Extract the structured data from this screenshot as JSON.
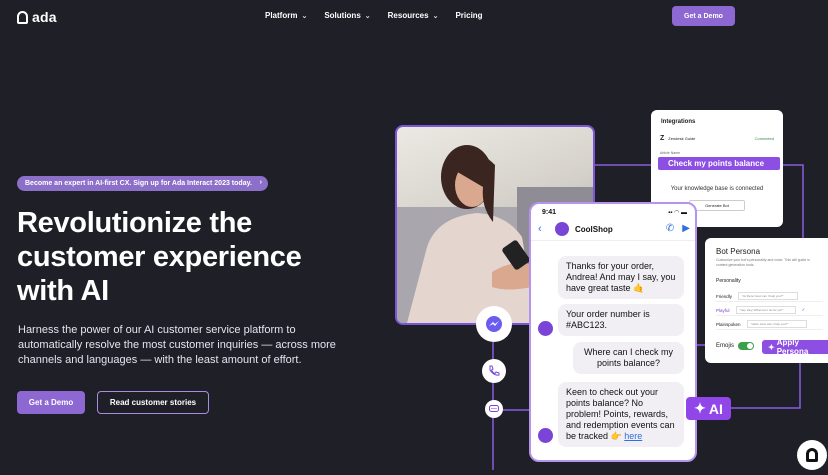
{
  "brand": {
    "name": "ada"
  },
  "nav": {
    "items": [
      {
        "label": "Platform",
        "dropdown": true
      },
      {
        "label": "Solutions",
        "dropdown": true
      },
      {
        "label": "Resources",
        "dropdown": true
      },
      {
        "label": "Pricing",
        "dropdown": false
      }
    ],
    "cta": "Get a Demo",
    "dropdown_glyph": "⌄"
  },
  "hero": {
    "announcement": "Become an expert in AI-first CX. Sign up for Ada Interact 2023 today.",
    "announcement_arrow": "›",
    "title": [
      "Revolutionize the",
      "customer experience",
      "with AI"
    ],
    "subtitle": "Harness the power of our AI customer service platform to automatically resolve the most customer inquiries — across more channels and languages — with the least amount of effort.",
    "primary_cta": "Get a Demo",
    "secondary_cta": "Read customer stories"
  },
  "integrations": {
    "title": "Integrations",
    "app": "Zendesk Guide",
    "app_logo": "Z",
    "status": "Connected",
    "field_label": "Article Name",
    "highlight": "Check my points balance",
    "kb_text": "Your knowledge base is connected",
    "button": "Generate Bot"
  },
  "phone": {
    "time": "9:41",
    "status_icons": "▪▪ ◠ ▬",
    "shop": "CoolShop",
    "back": "‹",
    "icons": [
      "✆",
      "▶"
    ],
    "messages": [
      {
        "from": "bot",
        "text": "Thanks for your order, Andrea! And may I say, you have great taste 🤙"
      },
      {
        "from": "bot",
        "text": "Your order number is #ABC123."
      },
      {
        "from": "user",
        "text": "Where can I check my points balance?"
      },
      {
        "from": "bot",
        "text": "Keen to check out your points balance? No problem! Points, rewards, and redemption events can be tracked 👉 ",
        "link": "here"
      }
    ]
  },
  "persona": {
    "title": "Bot Persona",
    "desc": "Customize your bot's personality and voice. This will guide in content generation tools.",
    "personality_label": "Personality",
    "options": [
      {
        "label": "Friendly",
        "sample": "\"Hi there! How can I help you?\""
      },
      {
        "label": "Playful",
        "sample": "\"Hey Hey! What can I do for ya?\""
      },
      {
        "label": "Plainspoken",
        "sample": "\"Hello. How can I help you?\""
      }
    ],
    "selected": "Playful",
    "check": "✓",
    "emojis_label": "Emojis",
    "emojis_on": true,
    "apply": "Apply Persona",
    "apply_icon": "✦"
  },
  "ai_badge": {
    "label": "AI",
    "icon": "✦"
  },
  "channels": [
    "messenger",
    "phone",
    "sms"
  ],
  "colors": {
    "bg": "#1f1f27",
    "accent": "#8d67d2",
    "highlight": "#8d4ee3"
  }
}
